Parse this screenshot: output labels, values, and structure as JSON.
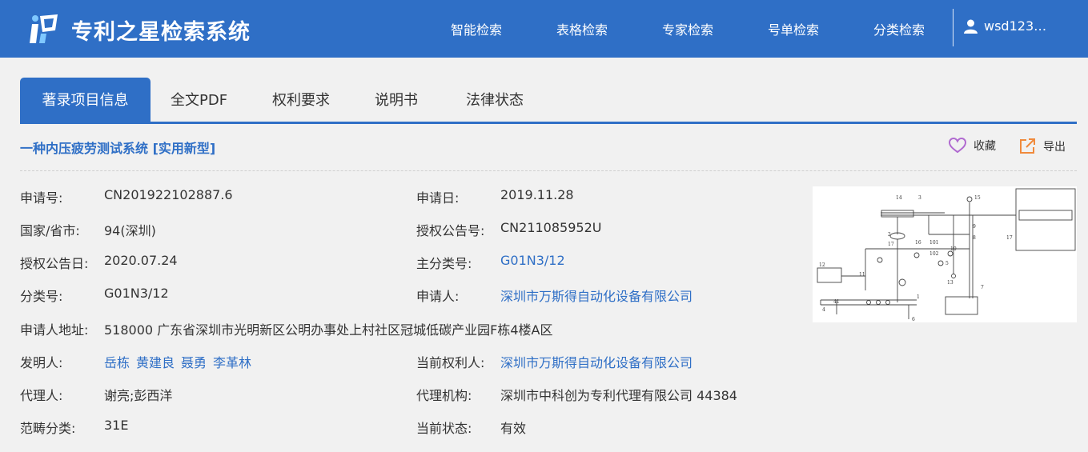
{
  "app": {
    "brand": "专利之星检索系统",
    "nav": [
      "智能检索",
      "表格检索",
      "专家检索",
      "号单检索",
      "分类检索"
    ],
    "user": "wsd123…"
  },
  "tabs": [
    "著录项目信息",
    "全文PDF",
    "权利要求",
    "说明书",
    "法律状态"
  ],
  "active_tab": 0,
  "patent": {
    "title": "一种内压疲劳测试系统 [实用新型]",
    "actions": {
      "favorite": "收藏",
      "export": "导出"
    },
    "fields": {
      "app_no_label": "申请号:",
      "app_no": "CN201922102887.6",
      "app_date_label": "申请日:",
      "app_date": "2019.11.28",
      "region_label": "国家/省市:",
      "region": "94(深圳)",
      "grant_pub_no_label": "授权公告号:",
      "grant_pub_no": "CN211085952U",
      "grant_pub_date_label": "授权公告日:",
      "grant_pub_date": "2020.07.24",
      "main_class_label": "主分类号:",
      "main_class": "G01N3/12",
      "class_label": "分类号:",
      "class_no": "G01N3/12",
      "applicant_label": "申请人:",
      "applicant": "深圳市万斯得自动化设备有限公司",
      "address_label": "申请人地址:",
      "address": "518000 广东省深圳市光明新区公明办事处上村社区冠城低碳产业园F栋4楼A区",
      "inventor_label": "发明人:",
      "inventors": [
        "岳栋",
        "黄建良",
        "聂勇",
        "李革林"
      ],
      "holder_label": "当前权利人:",
      "holder": "深圳市万斯得自动化设备有限公司",
      "agent_label": "代理人:",
      "agent": "谢亮;彭西洋",
      "agency_label": "代理机构:",
      "agency": "深圳市中科创为专利代理有限公司 44384",
      "category_label": "范畴分类:",
      "category": "31E",
      "status_label": "当前状态:",
      "status": "有效"
    },
    "drawing_labels": [
      "14",
      "3",
      "15",
      "2",
      "17",
      "16",
      "101",
      "102",
      "10",
      "5",
      "9",
      "8",
      "17",
      "11",
      "12",
      "13",
      "7",
      "4",
      "41",
      "1",
      "6"
    ]
  },
  "colors": {
    "primary": "#2f6fc6",
    "favorite": "#b06ad0",
    "export": "#f08a3c"
  }
}
